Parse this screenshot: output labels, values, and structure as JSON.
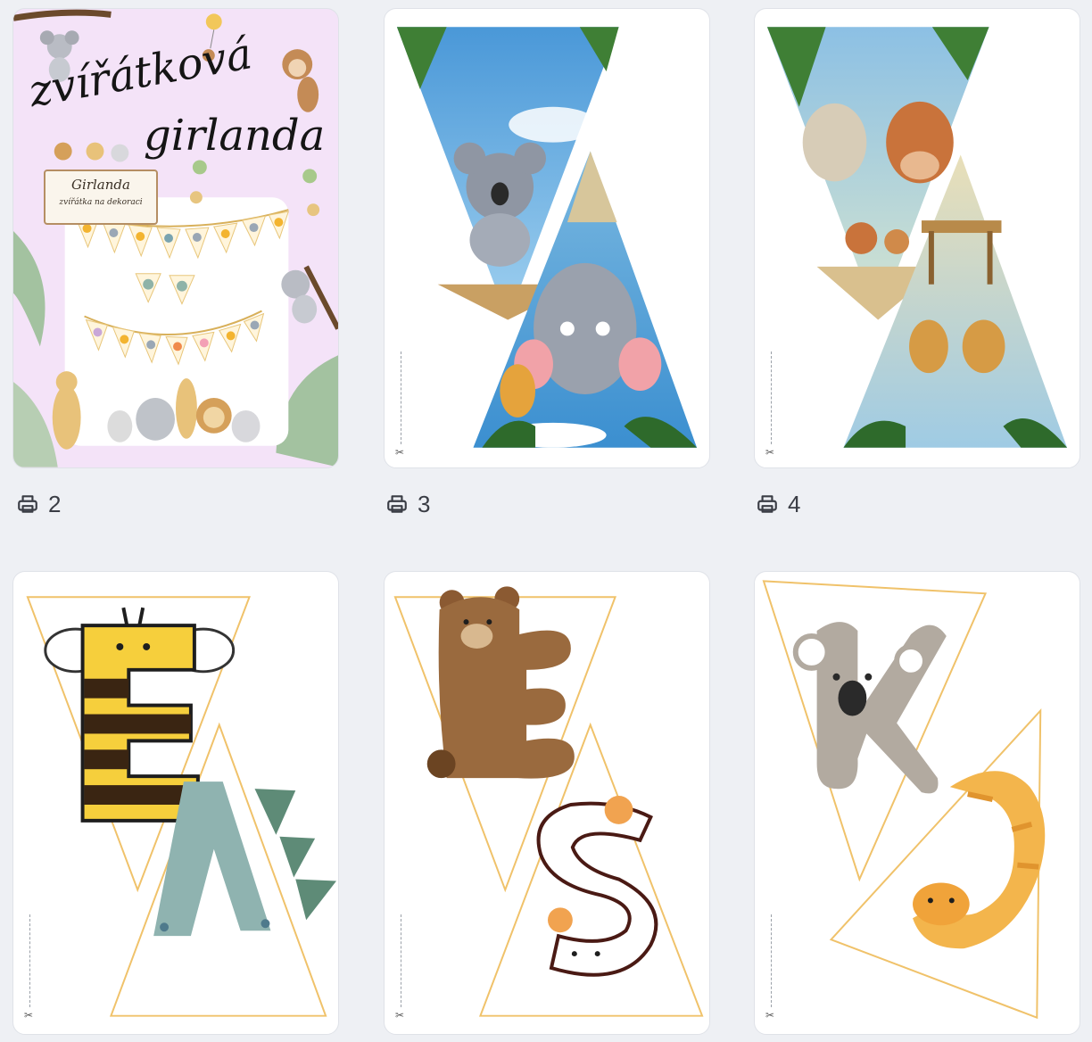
{
  "pages": [
    {
      "number": "2",
      "title_line1": "zvířátková",
      "title_line2": "girlanda",
      "sign_line1": "Girlanda",
      "sign_line2": "zvířátka na dekoraci"
    },
    {
      "number": "3"
    },
    {
      "number": "4"
    }
  ],
  "letter_pages": [
    {
      "letters": [
        "E",
        "Ň"
      ]
    },
    {
      "letters": [
        "E",
        "S"
      ]
    },
    {
      "letters": [
        "K",
        "J"
      ]
    }
  ],
  "icons": {
    "print": "printer-icon",
    "cut": "scissors-icon"
  },
  "colors": {
    "background": "#eef0f4",
    "cover": "#f4e3f8",
    "triangle_outline": "#f0c26a"
  }
}
